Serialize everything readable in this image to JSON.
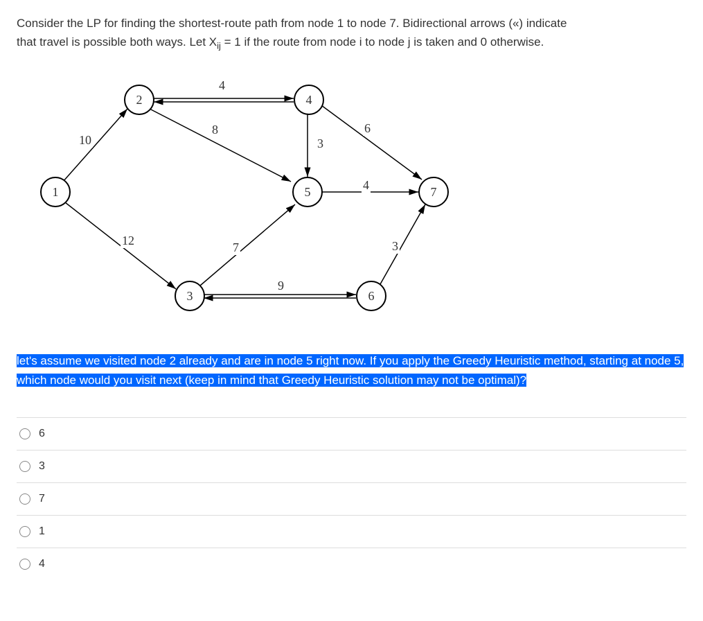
{
  "question": {
    "line1": "Consider the LP for finding the shortest-route path from node 1 to node 7. Bidirectional arrows («) indicate",
    "line2_a": "that travel is possible both ways. Let X",
    "line2_sub": "ij",
    "line2_b": " = 1 if the route from node i to node j is taken and 0 otherwise."
  },
  "nodes": {
    "n1": "1",
    "n2": "2",
    "n3": "3",
    "n4": "4",
    "n5": "5",
    "n6": "6",
    "n7": "7"
  },
  "edge_weights": {
    "e12": "10",
    "e24": "4",
    "e25": "8",
    "e45": "3",
    "e47": "6",
    "e57": "4",
    "e13": "12",
    "e35": "7",
    "e36": "9",
    "e67": "3"
  },
  "highlighted": "let's assume we visited node 2 already and are in node 5 right now. If you apply the Greedy Heuristic method, starting at node 5, which node would you visit next (keep in mind that Greedy Heuristic solution may not be optimal)?",
  "options": {
    "a": "6",
    "b": "3",
    "c": "7",
    "d": "1",
    "e": "4"
  }
}
